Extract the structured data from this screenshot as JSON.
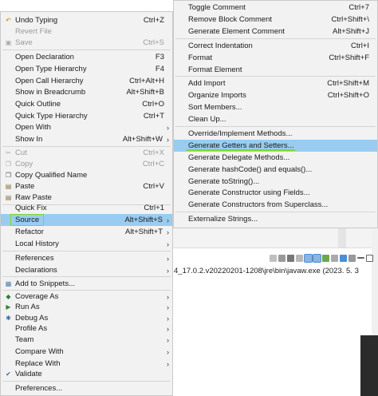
{
  "left_menu": {
    "items": [
      {
        "label": "Undo Typing",
        "shortcut": "Ctrl+Z",
        "icon": "undo-icon"
      },
      {
        "label": "Revert File",
        "shortcut": ""
      },
      {
        "label": "Save",
        "shortcut": "Ctrl+S",
        "icon": "save-icon"
      },
      {
        "label": "Open Declaration",
        "shortcut": "F3"
      },
      {
        "label": "Open Type Hierarchy",
        "shortcut": "F4"
      },
      {
        "label": "Open Call Hierarchy",
        "shortcut": "Ctrl+Alt+H"
      },
      {
        "label": "Show in Breadcrumb",
        "shortcut": "Alt+Shift+B"
      },
      {
        "label": "Quick Outline",
        "shortcut": "Ctrl+O"
      },
      {
        "label": "Quick Type Hierarchy",
        "shortcut": "Ctrl+T"
      },
      {
        "label": "Open With",
        "shortcut": ""
      },
      {
        "label": "Show In",
        "shortcut": "Alt+Shift+W"
      },
      {
        "label": "Cut",
        "shortcut": "Ctrl+X",
        "icon": "cut-icon"
      },
      {
        "label": "Copy",
        "shortcut": "Ctrl+C",
        "icon": "copy-icon"
      },
      {
        "label": "Copy Qualified Name",
        "shortcut": "",
        "icon": "copy-qualified-name-icon"
      },
      {
        "label": "Paste",
        "shortcut": "Ctrl+V",
        "icon": "paste-icon"
      },
      {
        "label": "Raw Paste",
        "shortcut": "",
        "icon": "raw-paste-icon"
      },
      {
        "label": "Quick Fix",
        "shortcut": "Ctrl+1"
      },
      {
        "label": "Source",
        "shortcut": "Alt+Shift+S"
      },
      {
        "label": "Refactor",
        "shortcut": "Alt+Shift+T"
      },
      {
        "label": "Local History",
        "shortcut": ""
      },
      {
        "label": "References",
        "shortcut": ""
      },
      {
        "label": "Declarations",
        "shortcut": ""
      },
      {
        "label": "Add to Snippets...",
        "shortcut": "",
        "icon": "snippet-icon"
      },
      {
        "label": "Coverage As",
        "shortcut": "",
        "icon": "coverage-icon"
      },
      {
        "label": "Run As",
        "shortcut": "",
        "icon": "run-icon"
      },
      {
        "label": "Debug As",
        "shortcut": "",
        "icon": "debug-icon"
      },
      {
        "label": "Profile As",
        "shortcut": ""
      },
      {
        "label": "Team",
        "shortcut": ""
      },
      {
        "label": "Compare With",
        "shortcut": ""
      },
      {
        "label": "Replace With",
        "shortcut": ""
      },
      {
        "label": "Validate",
        "shortcut": "",
        "icon": "validate-checkmark-icon"
      },
      {
        "label": "Preferences...",
        "shortcut": ""
      }
    ]
  },
  "right_menu": {
    "items": [
      {
        "label": "Toggle Comment",
        "shortcut": "Ctrl+7"
      },
      {
        "label": "Remove Block Comment",
        "shortcut": "Ctrl+Shift+\\"
      },
      {
        "label": "Generate Element Comment",
        "shortcut": "Alt+Shift+J"
      },
      {
        "label": "Correct Indentation",
        "shortcut": "Ctrl+I"
      },
      {
        "label": "Format",
        "shortcut": "Ctrl+Shift+F"
      },
      {
        "label": "Format Element",
        "shortcut": ""
      },
      {
        "label": "Add Import",
        "shortcut": "Ctrl+Shift+M"
      },
      {
        "label": "Organize Imports",
        "shortcut": "Ctrl+Shift+O"
      },
      {
        "label": "Sort Members...",
        "shortcut": ""
      },
      {
        "label": "Clean Up...",
        "shortcut": ""
      },
      {
        "label": "Override/Implement Methods...",
        "shortcut": ""
      },
      {
        "label": "Generate Getters and Setters...",
        "shortcut": ""
      },
      {
        "label": "Generate Delegate Methods...",
        "shortcut": ""
      },
      {
        "label": "Generate hashCode() and equals()...",
        "shortcut": ""
      },
      {
        "label": "Generate toString()...",
        "shortcut": ""
      },
      {
        "label": "Generate Constructor using Fields...",
        "shortcut": ""
      },
      {
        "label": "Generate Constructors from Superclass...",
        "shortcut": ""
      },
      {
        "label": "Externalize Strings...",
        "shortcut": ""
      }
    ]
  },
  "console": {
    "path_text": "4_17.0.2.v20220201-1208\\jre\\bin\\javaw.exe  (2023. 5. 3"
  },
  "colors": {
    "menu_bg": "#f2f2f2",
    "highlight": "#99ccf0",
    "marker_green": "#7ddc1f"
  }
}
